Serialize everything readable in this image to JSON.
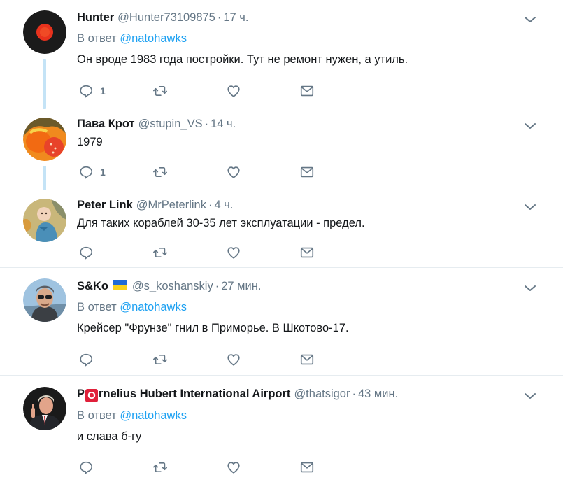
{
  "tweets": [
    {
      "name": "Hunter",
      "handle": "@Hunter73109875",
      "time": "17 ч.",
      "reply_prefix": "В ответ",
      "reply_to": "@natohawks",
      "text": "Он вроде 1983 года постройки. Тут не ремонт нужен, а утиль.",
      "reply_count": "1",
      "avatar": "red-dot-avatar"
    },
    {
      "name": "Пава Крот",
      "handle": "@stupin_VS",
      "time": "14 ч.",
      "text": "1979",
      "reply_count": "1",
      "avatar": "orange-illustration-avatar"
    },
    {
      "name": "Peter Link",
      "handle": "@MrPeterlink",
      "time": "4 ч.",
      "text": "Для таких кораблей 30-35 лет эксплуатации - предел.",
      "reply_count": "",
      "avatar": "child-photo-avatar"
    },
    {
      "name": "S&Ko",
      "flag": "ukraine-flag-icon",
      "handle": "@s_koshanskiy",
      "time": "27 мин.",
      "reply_prefix": "В ответ",
      "reply_to": "@natohawks",
      "text": "Крейсер \"Фрунзе\" гнил в Приморье. В Шкотово-17.",
      "reply_count": "",
      "avatar": "man-sunglasses-avatar"
    },
    {
      "name_pre": "P",
      "name_badge": "O",
      "name_post": "rnelius Hubert International Airport",
      "handle": "@thatsigor",
      "time": "43 мин.",
      "reply_prefix": "В ответ",
      "reply_to": "@natohawks",
      "text": "и слава б-гу",
      "reply_count": "",
      "avatar": "man-suit-avatar"
    }
  ],
  "separator": "·",
  "colors": {
    "link": "#1da1f2",
    "secondary_text": "#657786",
    "thread_line": "#c4e3f6",
    "divider": "#e6ecf0"
  },
  "icons": [
    "reply-icon",
    "retweet-icon",
    "like-icon",
    "dm-icon",
    "chevron-down-icon"
  ]
}
